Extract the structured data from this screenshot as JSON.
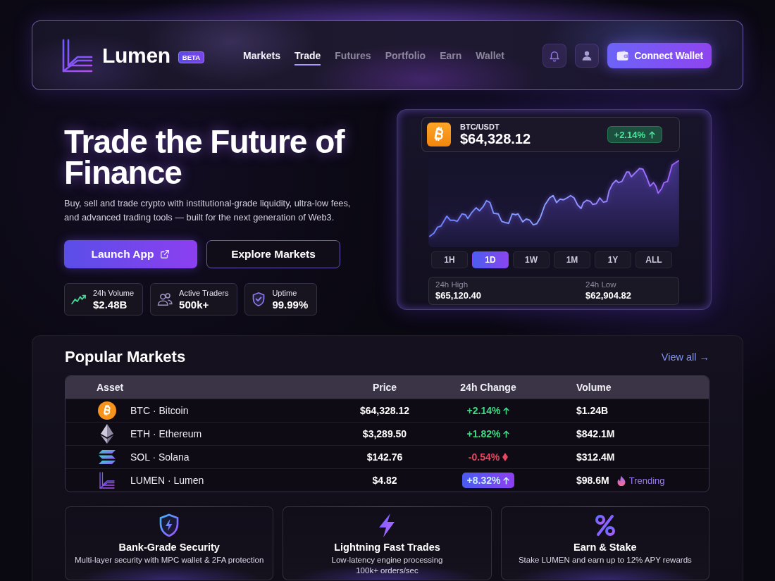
{
  "nav": {
    "brand": "Lumen",
    "badge": "BETA",
    "links": [
      {
        "label": "Markets",
        "selected": false,
        "muted": false
      },
      {
        "label": "Trade",
        "selected": true,
        "muted": false
      },
      {
        "label": "Futures",
        "selected": false,
        "muted": true
      },
      {
        "label": "Portfolio",
        "selected": false,
        "muted": true
      },
      {
        "label": "Earn",
        "selected": false,
        "muted": true
      },
      {
        "label": "Wallet",
        "selected": false,
        "muted": true
      }
    ],
    "connect_button": "Connect Wallet"
  },
  "hero": {
    "title": "Trade the Future of Finance",
    "subtitle": "Buy, sell and trade crypto with institutional-grade liquidity, ultra-low fees, and advanced trading tools — built for the next generation of Web3.",
    "buttons": [
      {
        "label": "Launch App",
        "kind": "primary"
      },
      {
        "label": "Explore Markets",
        "kind": "outline"
      }
    ],
    "stats": [
      {
        "label": "24h Volume",
        "value": "$2.48B"
      },
      {
        "label": "Active Traders",
        "value": "500k+"
      },
      {
        "label": "Uptime",
        "value": "99.99%"
      }
    ]
  },
  "ticker": {
    "pair": "BTC/USDT",
    "price": "$64,328.12",
    "change": "+2.14%",
    "rising": true,
    "timeframes": [
      {
        "label": "1H",
        "selected": false
      },
      {
        "label": "1D",
        "selected": true
      },
      {
        "label": "1W",
        "selected": false
      },
      {
        "label": "1M",
        "selected": false
      },
      {
        "label": "1Y",
        "selected": false
      },
      {
        "label": "ALL",
        "selected": false
      }
    ],
    "range": [
      {
        "label": "24h High",
        "value": "$65,120.40"
      },
      {
        "label": "24h Low",
        "value": "$62,904.82"
      }
    ]
  },
  "markets": {
    "title": "Popular Markets",
    "view_all": "View all →",
    "columns": [
      "Asset",
      "Price",
      "24h Change",
      "Volume"
    ],
    "rows": [
      {
        "asset": "BTC · Bitcoin",
        "price": "$64,328.12",
        "change": "+2.14%",
        "rising": true,
        "highlighted": false,
        "volume": "$1.24B"
      },
      {
        "asset": "ETH · Ethereum",
        "price": "$3,289.50",
        "change": "+1.82%",
        "rising": true,
        "highlighted": false,
        "volume": "$842.1M"
      },
      {
        "asset": "SOL · Solana",
        "price": "$142.76",
        "change": "-0.54%",
        "rising": false,
        "highlighted": false,
        "volume": "$312.4M"
      },
      {
        "asset": "LUMEN · Lumen",
        "price": "$4.82",
        "change": "+8.32%",
        "rising": true,
        "highlighted": true,
        "volume": "$98.6M",
        "tag": "Trending"
      }
    ]
  },
  "features": [
    {
      "title": "Bank-Grade Security",
      "text": "Multi-layer security with MPC wallet & 2FA protection"
    },
    {
      "title": "Lightning Fast Trades",
      "text": "Low-latency engine processing\n100k+ orders/sec"
    },
    {
      "title": "Earn & Stake",
      "text": "Stake LUMEN and earn up to 12% APY rewards"
    }
  ]
}
